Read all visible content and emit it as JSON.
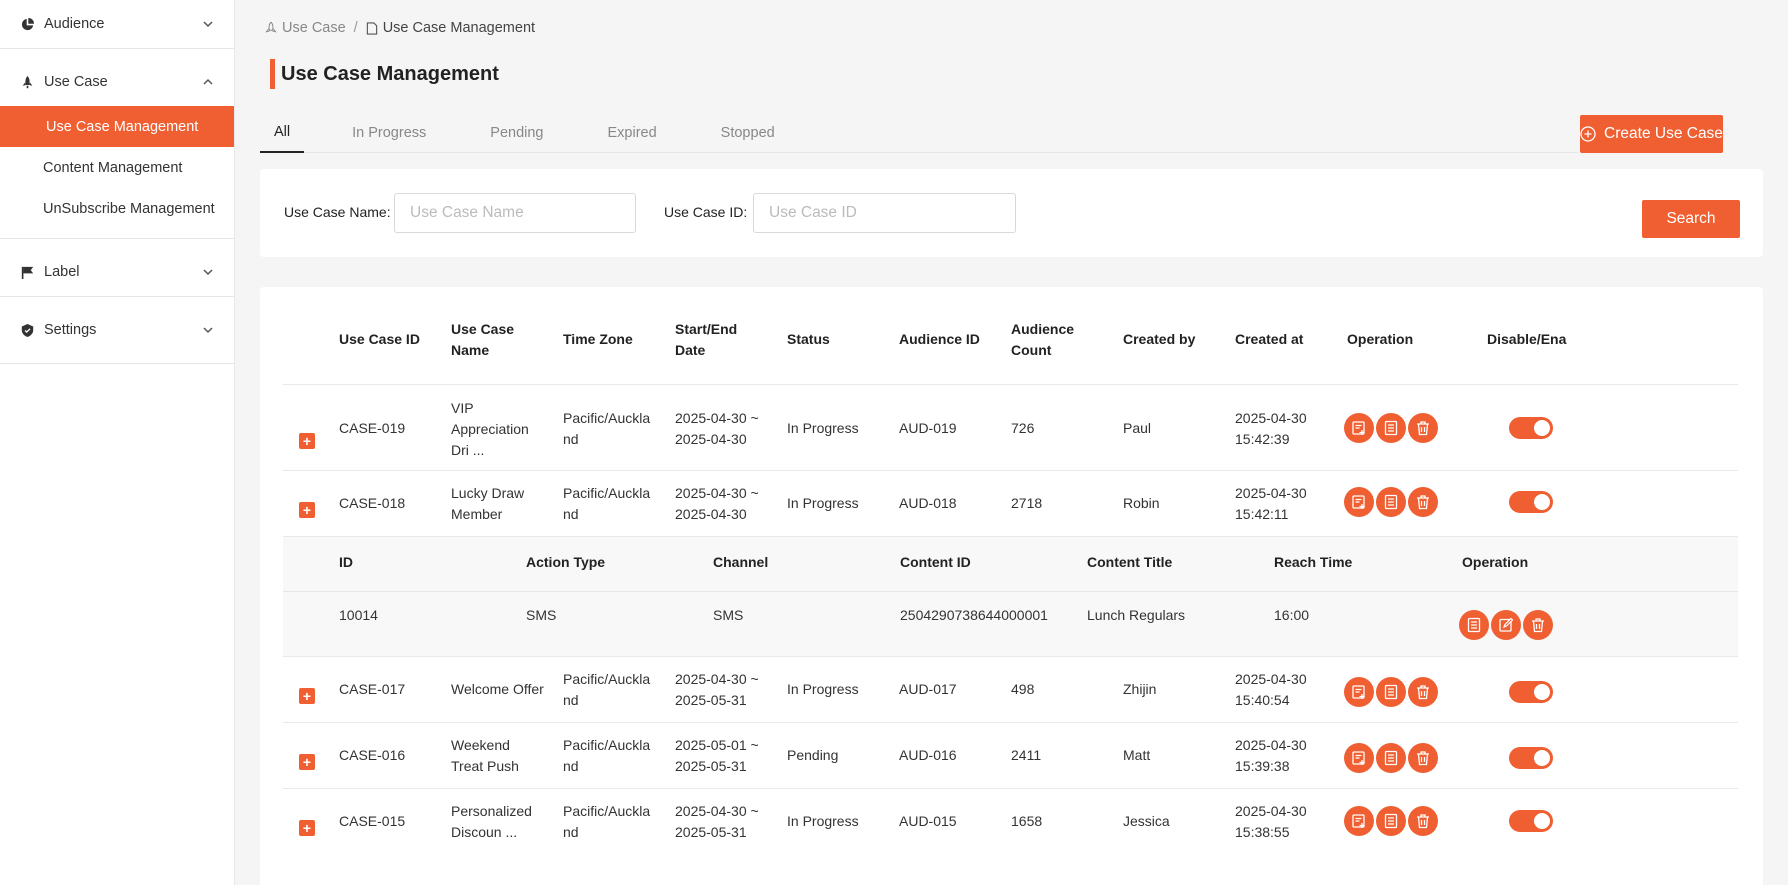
{
  "sidebar": {
    "groups": [
      {
        "label": "Audience",
        "icon": "pie-chart-icon",
        "expanded": false
      },
      {
        "label": "Use Case",
        "icon": "rocket-icon",
        "expanded": true,
        "items": [
          {
            "label": "Use Case Management",
            "active": true
          },
          {
            "label": "Content Management",
            "active": false
          },
          {
            "label": "UnSubscribe Management",
            "active": false
          }
        ]
      },
      {
        "label": "Label",
        "icon": "flag-icon",
        "expanded": false
      },
      {
        "label": "Settings",
        "icon": "shield-icon",
        "expanded": false
      }
    ]
  },
  "breadcrumb": {
    "root": "Use Case",
    "sep": "/",
    "current": "Use Case Management"
  },
  "page_title": "Use Case Management",
  "tabs": [
    {
      "label": "All",
      "active": true
    },
    {
      "label": "In Progress",
      "active": false
    },
    {
      "label": "Pending",
      "active": false
    },
    {
      "label": "Expired",
      "active": false
    },
    {
      "label": "Stopped",
      "active": false
    }
  ],
  "create_button": "Create Use Case",
  "filters": {
    "name_label": "Use Case Name:",
    "name_placeholder": "Use Case Name",
    "id_label": "Use Case ID:",
    "id_placeholder": "Use Case ID",
    "search_button": "Search"
  },
  "table": {
    "headers": {
      "id": "Use Case ID",
      "name": "Use Case Name",
      "tz": "Time Zone",
      "dates": "Start/End Date",
      "status": "Status",
      "audience_id": "Audience ID",
      "audience_count": "Audience Count",
      "created_by": "Created by",
      "created_at": "Created at",
      "operation": "Operation",
      "toggle": "Disable/Ena"
    },
    "rows": [
      {
        "id": "CASE-019",
        "name": "VIP Appreciation Dri ...",
        "tz": "Pacific/Auckland",
        "dates": "2025-04-30 ~ 2025-04-30",
        "status": "In Progress",
        "audience_id": "AUD-019",
        "audience_count": "726",
        "created_by": "Paul",
        "created_at": "2025-04-30 15:42:39",
        "enabled": true
      },
      {
        "id": "CASE-018",
        "name": "Lucky Draw Member",
        "tz": "Pacific/Auckland",
        "dates": "2025-04-30 ~ 2025-04-30",
        "status": "In Progress",
        "audience_id": "AUD-018",
        "audience_count": "2718",
        "created_by": "Robin",
        "created_at": "2025-04-30 15:42:11",
        "enabled": true
      },
      {
        "id": "CASE-017",
        "name": "Welcome Offer",
        "tz": "Pacific/Auckland",
        "dates": "2025-04-30 ~ 2025-05-31",
        "status": "In Progress",
        "audience_id": "AUD-017",
        "audience_count": "498",
        "created_by": "Zhijin",
        "created_at": "2025-04-30 15:40:54",
        "enabled": true
      },
      {
        "id": "CASE-016",
        "name": "Weekend Treat Push",
        "tz": "Pacific/Auckland",
        "dates": "2025-05-01 ~ 2025-05-31",
        "status": "Pending",
        "audience_id": "AUD-016",
        "audience_count": "2411",
        "created_by": "Matt",
        "created_at": "2025-04-30 15:39:38",
        "enabled": true
      },
      {
        "id": "CASE-015",
        "name": "Personalized Discoun ...",
        "tz": "Pacific/Auckland",
        "dates": "2025-04-30 ~ 2025-05-31",
        "status": "In Progress",
        "audience_id": "AUD-015",
        "audience_count": "1658",
        "created_by": "Jessica",
        "created_at": "2025-04-30 15:38:55",
        "enabled": true
      }
    ],
    "sub_table": {
      "headers": {
        "id": "ID",
        "action_type": "Action Type",
        "channel": "Channel",
        "content_id": "Content ID",
        "content_title": "Content Title",
        "reach_time": "Reach Time",
        "operation": "Operation"
      },
      "row": {
        "id": "10014",
        "action_type": "SMS",
        "channel": "SMS",
        "content_id": "2504290738644000001",
        "content_title": "Lunch Regulars",
        "reach_time": "16:00"
      }
    }
  },
  "colors": {
    "accent": "#ef5f31",
    "sidebar_bg": "#ffffff",
    "page_bg": "#f5f5f6"
  }
}
